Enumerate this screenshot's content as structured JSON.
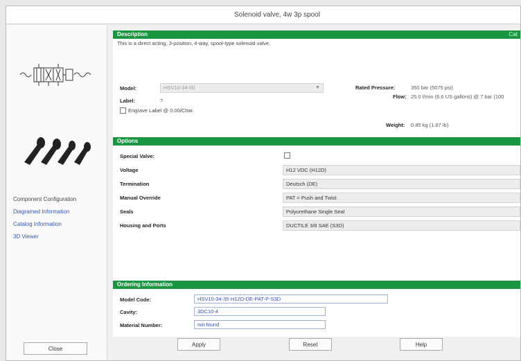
{
  "window": {
    "title": "Solenoid valve, 4w 3p spool"
  },
  "left_panel": {
    "nav": [
      {
        "label": "Component Configuration"
      },
      {
        "label": "Diagramed Information"
      },
      {
        "label": "Catalog Information"
      },
      {
        "label": "3D Viewer"
      }
    ],
    "close_label": "Close"
  },
  "description": {
    "header": "Description",
    "header_link": "Cat",
    "text": "This is a direct acting, 3-position, 4-way, spool-type solenoid valve.",
    "model_label": "Model:",
    "model_value": "HSV10-34-00",
    "label_label": "Label:",
    "label_value": "?",
    "engrave_label": "Engrave Label @ 0.00/Char.",
    "rated_pressure_label": "Rated Pressure:",
    "rated_pressure_value": "350 bar (5075 psi)",
    "flow_label": "Flow:",
    "flow_value": "25.0 l/min (6.6 US gallons) @ 7 bar (100",
    "weight_label": "Weight:",
    "weight_value": "0.85 kg (1.87 lb)"
  },
  "options": {
    "header": "Options",
    "special_valve_label": "Special Valve:",
    "rows": [
      {
        "label": "Voltage",
        "value": "H12 VDC (H12D)"
      },
      {
        "label": "Termination",
        "value": "Deutsch (DE)"
      },
      {
        "label": "Manual Override",
        "value": "PAT = Push and Twist"
      },
      {
        "label": "Seals",
        "value": "Polyurethane Single Seal"
      },
      {
        "label": "Housing and Ports",
        "value": "DUCTILE 3/8 SAE (S3D)"
      }
    ]
  },
  "ordering": {
    "header": "Ordering Information",
    "model_code_label": "Model Code:",
    "model_code_value": "HSV10-34-35-H12D-DE-PAT-P-S3D",
    "cavity_label": "Cavity:",
    "cavity_value": "3DC10-4",
    "material_label": "Material Number:",
    "material_value": "not found"
  },
  "buttons": {
    "apply": "Apply",
    "reset": "Reset",
    "help": "Help"
  }
}
